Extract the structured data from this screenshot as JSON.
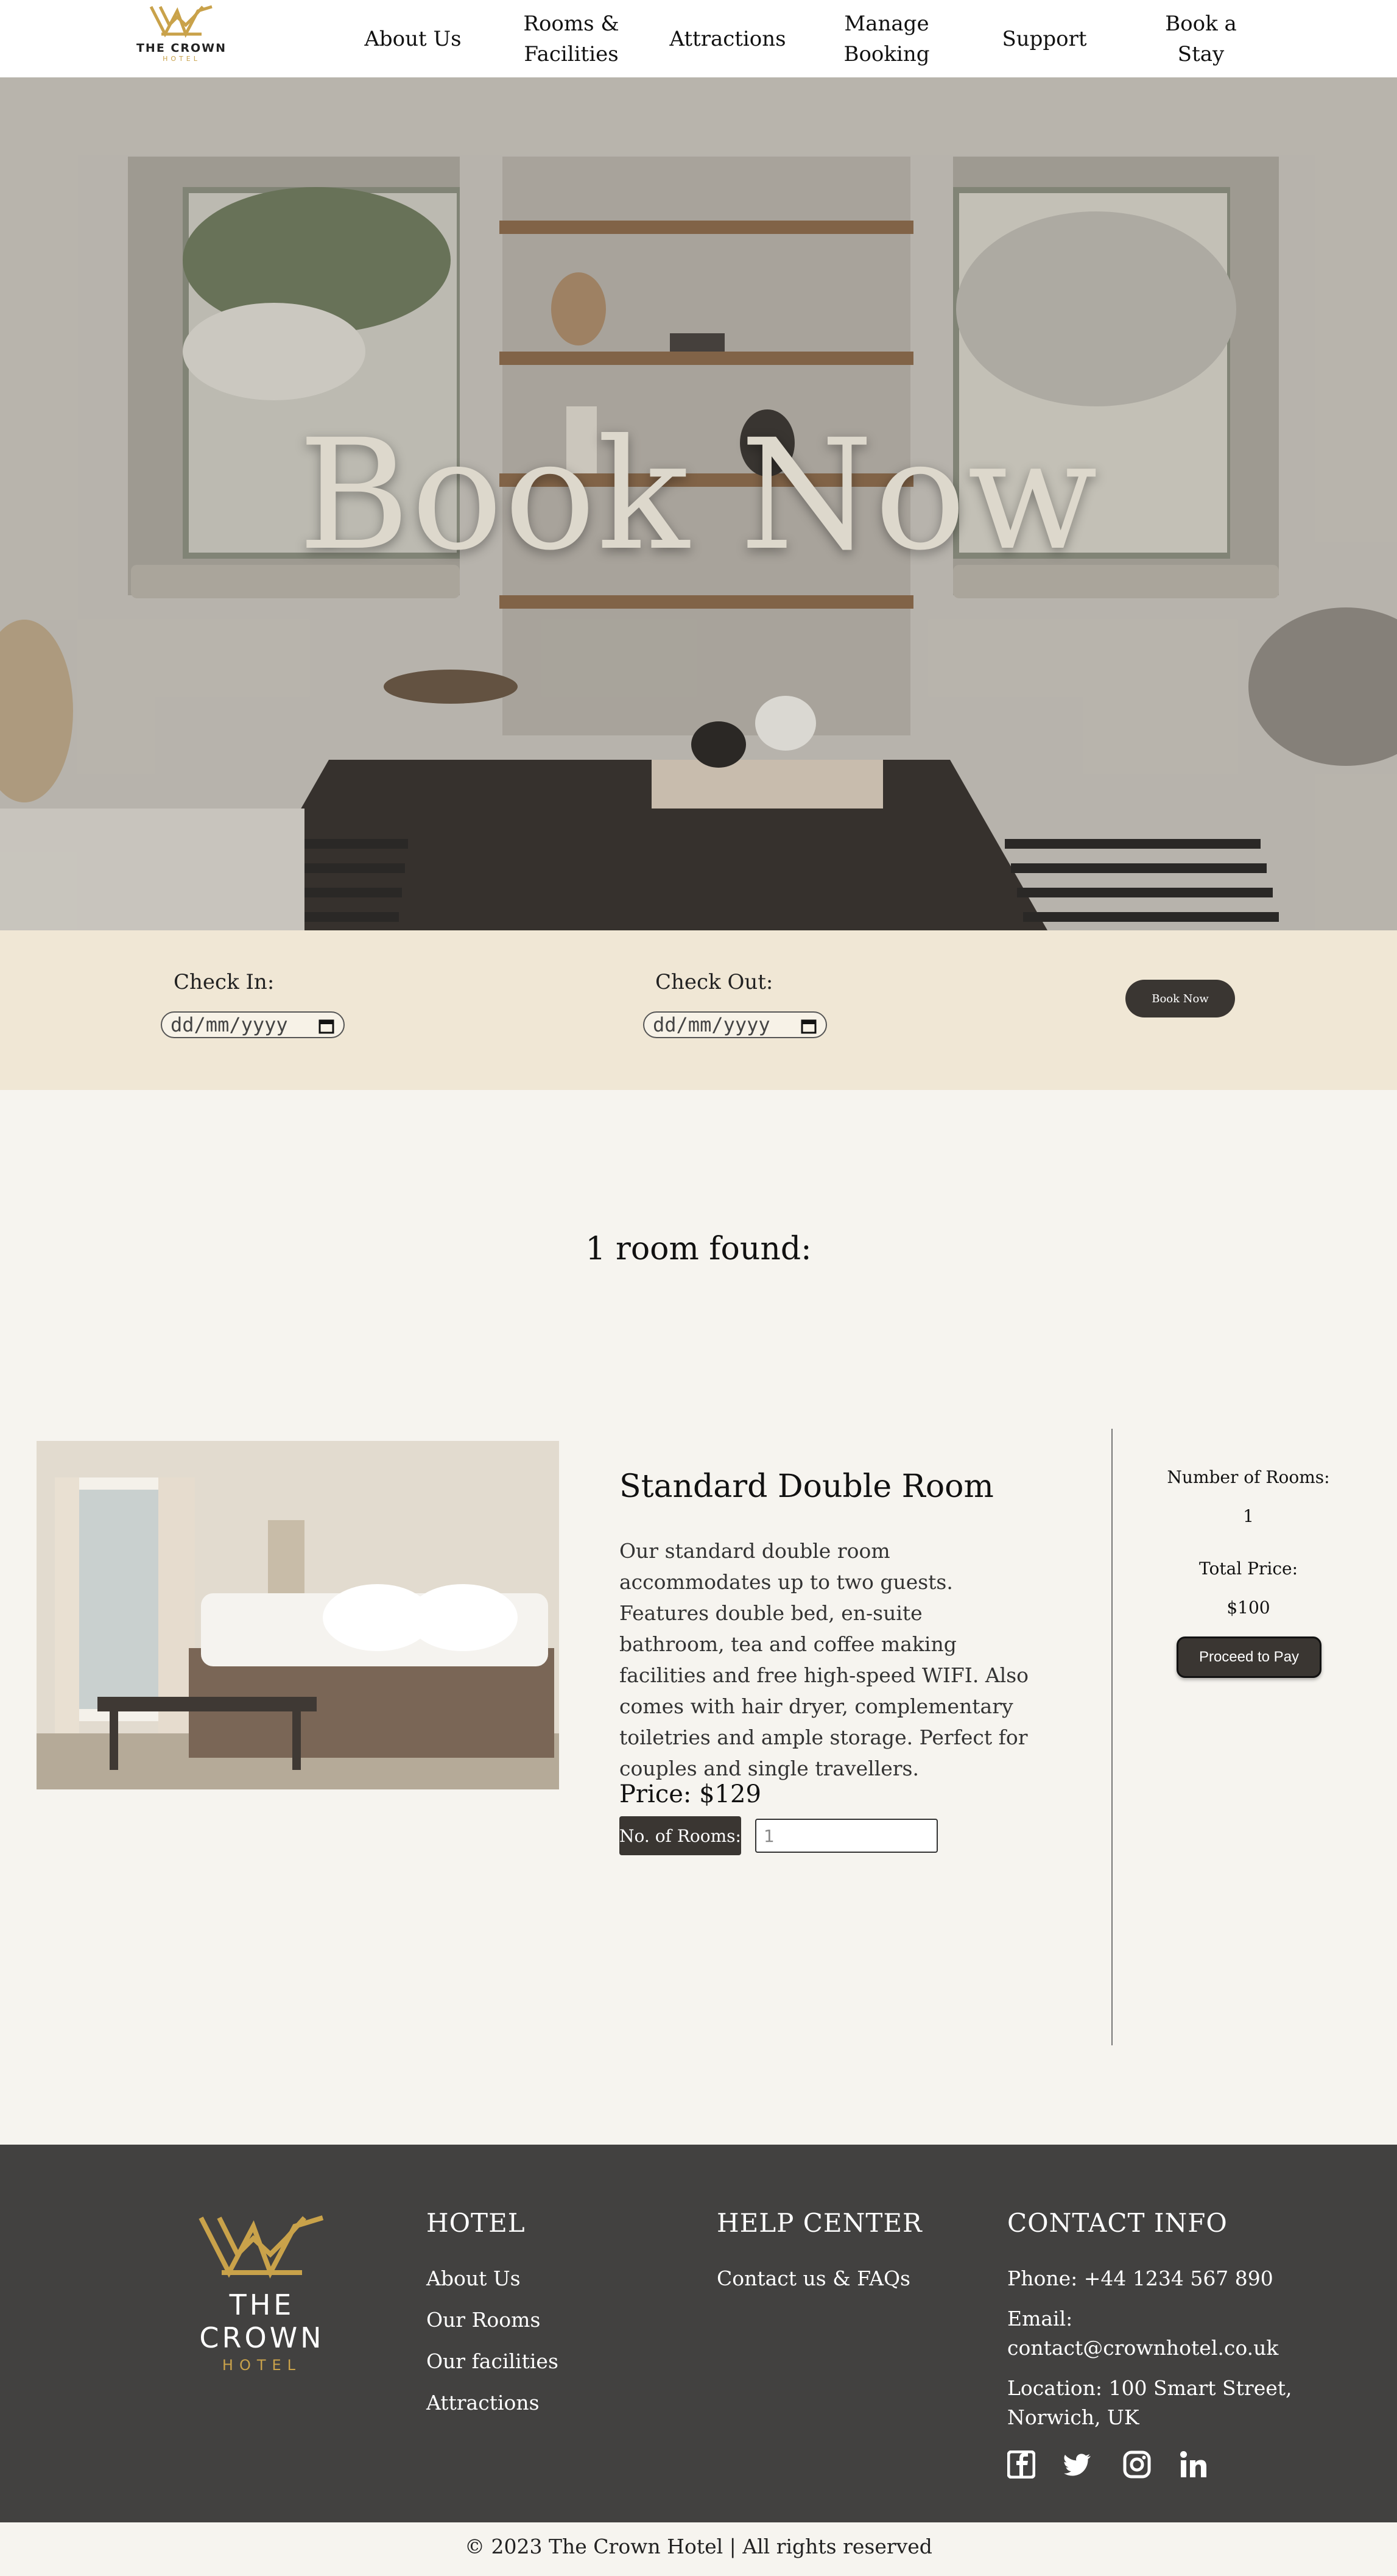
{
  "nav": {
    "logo_line1": "THE CROWN",
    "logo_line2": "HOTEL",
    "items": [
      "About Us",
      "Rooms &\nFacilities",
      "Attractions",
      "Manage\nBooking",
      "Support",
      "Book a Stay"
    ]
  },
  "hero": {
    "title": "Book Now"
  },
  "booking": {
    "checkin_label": "Check In:",
    "checkout_label": "Check Out:",
    "checkin_placeholder": "dd/mm/yyyy",
    "checkout_placeholder": "dd/mm/yyyy",
    "button": "Book Now"
  },
  "results": {
    "found": "1 room found:",
    "room": {
      "title": "Standard Double Room",
      "description": "Our standard double room accommodates up to two guests. Features double bed, en-suite bathroom, tea and coffee making facilities and free high-speed WIFI. Also comes with hair dryer, complementary toiletries and ample storage. Perfect for couples and single travellers.",
      "price": "Price: $129",
      "rooms_label": "No. of Rooms:",
      "rooms_placeholder": "1"
    },
    "summary": {
      "rooms_label": "Number of Rooms:",
      "rooms_value": "1",
      "total_label": "Total Price:",
      "total_value": "$100",
      "pay_button": "Proceed to Pay"
    }
  },
  "footer": {
    "logo_line1": "THE CROWN",
    "logo_line2": "HOTEL",
    "hotel": {
      "heading": "HOTEL",
      "links": [
        "About Us",
        "Our Rooms",
        "Our facilities",
        "Attractions"
      ]
    },
    "help": {
      "heading": "HELP CENTER",
      "links": [
        "Contact us & FAQs"
      ]
    },
    "contact": {
      "heading": "CONTACT INFO",
      "phone": "Phone: +44 1234 567 890",
      "email_label": "Email:",
      "email": "contact@crownhotel.co.uk",
      "location1": "Location: 100 Smart Street,",
      "location2": "Norwich, UK"
    },
    "social_icons": [
      "facebook-icon",
      "twitter-icon",
      "instagram-icon",
      "linkedin-icon"
    ]
  },
  "copyright": "© 2023 The Crown Hotel | All rights reserved",
  "colors": {
    "gold": "#c9a24a",
    "dark": "#3a3632",
    "footer_bg": "#424140",
    "bookbar_bg": "#f0e7d5",
    "page_bg": "#f6f4ef"
  }
}
